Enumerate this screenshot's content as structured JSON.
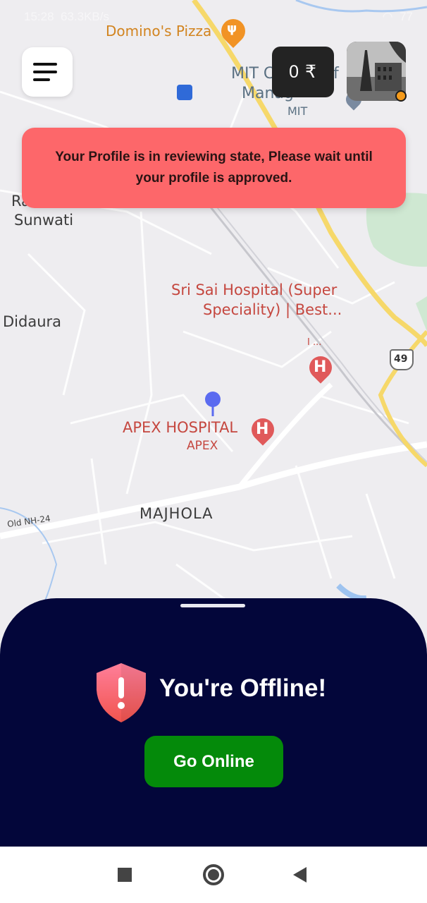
{
  "status_bar": {
    "time": "15:28",
    "speed": "63.3KB/s",
    "battery": "77"
  },
  "map": {
    "labels": {
      "dominos": "Domino's Pizza",
      "mit_line1": "MIT C",
      "mit_line1b": "f",
      "mit_line2": "Manag",
      "mit_short": "MIT",
      "ra": "Ra",
      "sunwati": "Sunwati",
      "sri_sai_1": "Sri Sai Hospital (Super",
      "sri_sai_2": "Speciality) | Best...",
      "sri_sai_3": "I ...",
      "didaura": "Didaura",
      "apex_hospital": "APEX HOSPITAL",
      "apex": "APEX",
      "majhola": "MAJHOLA",
      "old_nh": "Old NH-24",
      "hwy_49": "49",
      "hospital_marker": "H"
    },
    "colors": {
      "poi_red": "#c5473f",
      "poi_orange": "#d2841f",
      "road_yellow": "#f6d86a",
      "pin_blue": "#5b6bf0"
    }
  },
  "header": {
    "menu_icon": "hamburger-icon",
    "wallet_amount": "0 ₹"
  },
  "banner": {
    "message": "Your Profile is in reviewing state, Please wait until your profile is approved.",
    "color": "#fd676a"
  },
  "bottom_sheet": {
    "status_title": "You're Offline!",
    "go_online_label": "Go Online",
    "shield_icon": "shield-alert-icon",
    "bg_color": "#03063a",
    "button_color": "#048a0a"
  },
  "nav_bar": {
    "recent": "square-icon",
    "home": "circle-icon",
    "back": "triangle-back-icon"
  }
}
